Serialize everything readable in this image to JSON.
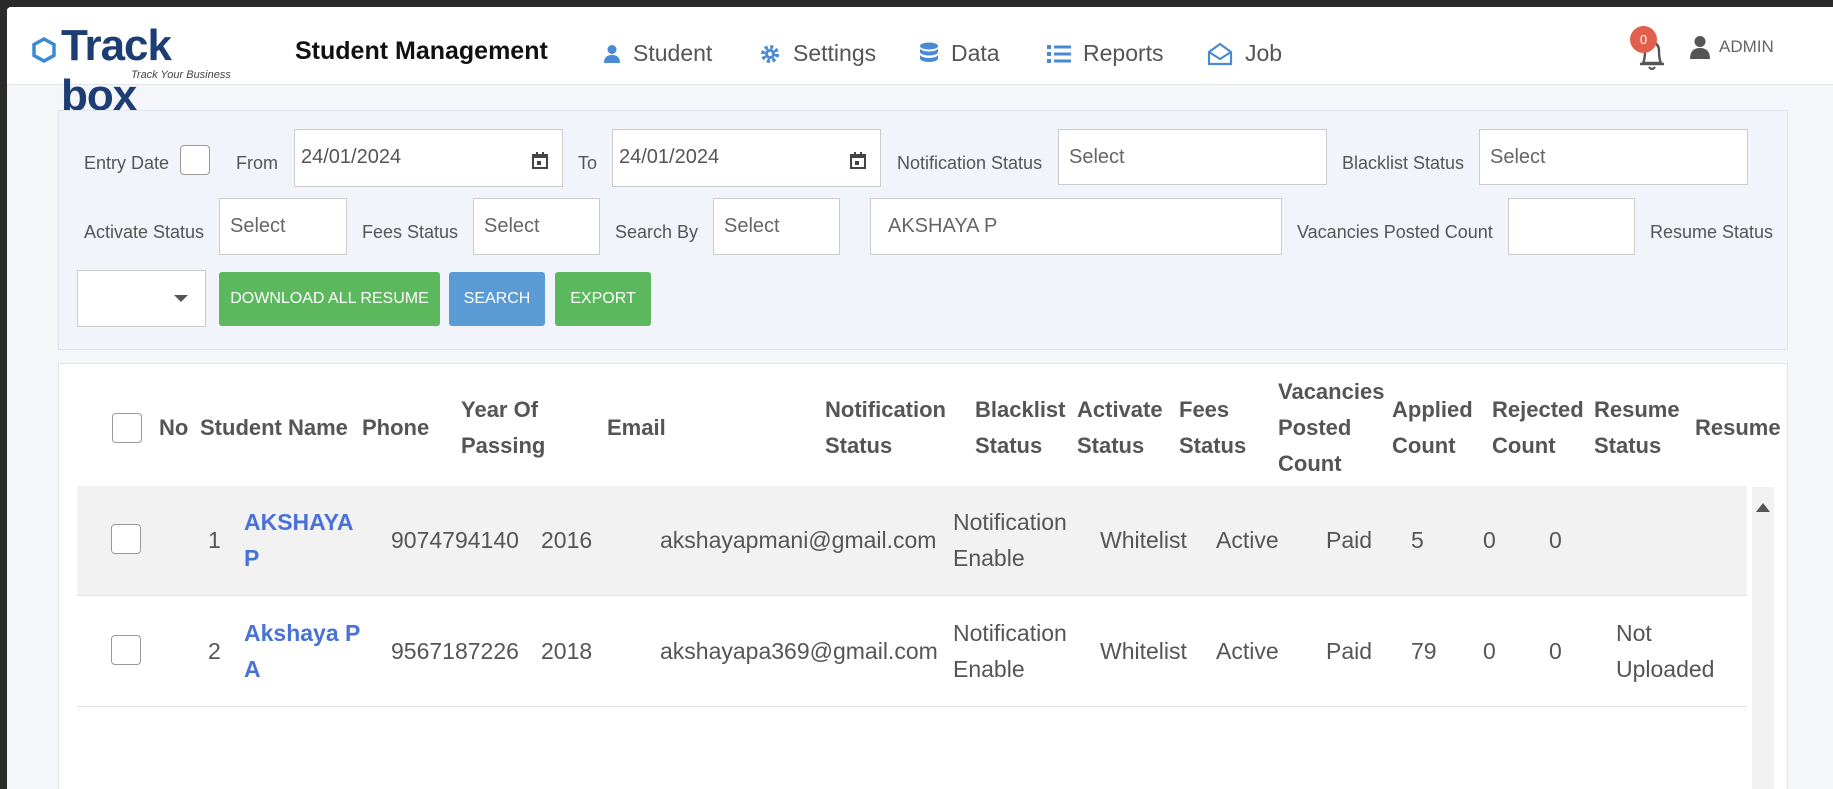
{
  "header": {
    "logo_text": "Track box",
    "logo_tagline": "Track Your Business",
    "title": "Student Management",
    "nav": [
      {
        "label": "Student",
        "icon": "user-icon"
      },
      {
        "label": "Settings",
        "icon": "gear-icon"
      },
      {
        "label": "Data",
        "icon": "database-icon"
      },
      {
        "label": "Reports",
        "icon": "list-icon"
      },
      {
        "label": "Job",
        "icon": "envelope-open-icon"
      }
    ],
    "notification_count": "0",
    "user": "ADMIN"
  },
  "filters": {
    "entry_date_label": "Entry Date",
    "from_label": "From",
    "from_value": "24/01/2024",
    "to_label": "To",
    "to_value": "24/01/2024",
    "notification_status_label": "Notification Status",
    "notification_status_value": "Select",
    "blacklist_status_label": "Blacklist Status",
    "blacklist_status_value": "Select",
    "activate_status_label": "Activate Status",
    "activate_status_value": "Select",
    "fees_status_label": "Fees Status",
    "fees_status_value": "Select",
    "search_by_label": "Search By",
    "search_by_value": "Select",
    "search_text": "AKSHAYA P",
    "vacancies_posted_count_label": "Vacancies Posted Count",
    "vacancies_posted_count_value": "",
    "resume_status_label": "Resume Status",
    "resume_status_value": "",
    "download_all_resume_label": "DOWNLOAD ALL RESUME",
    "search_label": "SEARCH",
    "export_label": "EXPORT"
  },
  "table": {
    "headers": {
      "no": "No",
      "student_name": "Student Name",
      "phone": "Phone",
      "year_of_passing_1": "Year Of",
      "year_of_passing_2": "Passing",
      "email": "Email",
      "notification_status_1": "Notification",
      "notification_status_2": "Status",
      "blacklist_status_1": "Blacklist",
      "blacklist_status_2": "Status",
      "activate_status_1": "Activate",
      "activate_status_2": "Status",
      "fees_status_1": "Fees",
      "fees_status_2": "Status",
      "vacancies_1": "Vacancies",
      "vacancies_2": "Posted",
      "vacancies_3": "Count",
      "applied_1": "Applied",
      "applied_2": "Count",
      "rejected_1": "Rejected",
      "rejected_2": "Count",
      "resume_status_1": "Resume",
      "resume_status_2": "Status",
      "resume": "Resume"
    },
    "rows": [
      {
        "no": "1",
        "name_1": "AKSHAYA",
        "name_2": "P",
        "phone": "9074794140",
        "year": "2016",
        "email": "akshayapmani@gmail.com",
        "notification_1": "Notification",
        "notification_2": "Enable",
        "blacklist": "Whitelist",
        "activate": "Active",
        "fees": "Paid",
        "vacancies": "5",
        "applied": "0",
        "rejected": "0",
        "resume_status_1": "",
        "resume_status_2": ""
      },
      {
        "no": "2",
        "name_1": "Akshaya P",
        "name_2": "A",
        "phone": "9567187226",
        "year": "2018",
        "email": "akshayapa369@gmail.com",
        "notification_1": "Notification",
        "notification_2": "Enable",
        "blacklist": "Whitelist",
        "activate": "Active",
        "fees": "Paid",
        "vacancies": "79",
        "applied": "0",
        "rejected": "0",
        "resume_status_1": "Not",
        "resume_status_2": "Uploaded"
      }
    ]
  }
}
